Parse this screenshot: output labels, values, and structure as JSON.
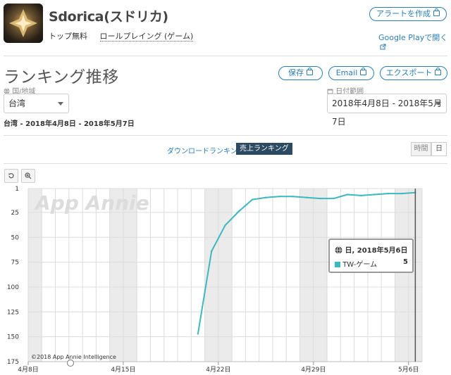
{
  "app": {
    "name": "Sdorica(スドリカ)",
    "category": "トップ無料",
    "genre": "ロールプレイング (ゲーム)"
  },
  "header_actions": {
    "alert_button": "アラートを作成",
    "google_play_link": "Google Playで開く"
  },
  "page_title": "ランキング推移",
  "export_buttons": {
    "save": "保存",
    "email": "Email",
    "export": "エクスポート"
  },
  "filters": {
    "country_label": "国/地域",
    "country_value": "台湾",
    "date_label": "日付範囲",
    "date_value": "2018年4月8日 - 2018年5月7日"
  },
  "range_summary": "台湾 - 2018年4月8日 - 2018年5月7日",
  "tabs": {
    "download": "ダウンロードランキング",
    "revenue": "売上ランキング"
  },
  "granularity": {
    "hourly": "時間",
    "daily": "日"
  },
  "watermark": "App Annie",
  "copyright": "©2018 App Annie Intelligence",
  "tooltip": {
    "date": "日, 2018年5月6日",
    "series": "TW-ゲーム",
    "value": "5"
  },
  "colors": {
    "line": "#3cb8c0",
    "accent": "#2b7db8",
    "weekend_band": "#ebebeb"
  },
  "chart_data": {
    "type": "line",
    "xlabel": "",
    "ylabel": "",
    "x_ticks": [
      "4月8日",
      "4月15日",
      "4月22日",
      "4月29日",
      "5月6日"
    ],
    "y_ticks": [
      1,
      25,
      50,
      75,
      100,
      125,
      150,
      175
    ],
    "ylim": [
      1,
      175
    ],
    "y_inverted": true,
    "x_range": [
      "2018-04-08",
      "2018-05-07"
    ],
    "grid": true,
    "series": [
      {
        "name": "TW-ゲーム",
        "x": [
          "2018-04-20",
          "2018-04-21",
          "2018-04-22",
          "2018-04-23",
          "2018-04-24",
          "2018-04-25",
          "2018-04-26",
          "2018-04-27",
          "2018-04-28",
          "2018-04-29",
          "2018-04-30",
          "2018-05-01",
          "2018-05-02",
          "2018-05-03",
          "2018-05-04",
          "2018-05-05",
          "2018-05-06"
        ],
        "values": [
          147,
          64,
          38,
          24,
          12,
          10,
          9,
          9,
          10,
          11,
          11,
          7,
          8,
          7,
          6,
          6,
          5
        ]
      }
    ]
  }
}
